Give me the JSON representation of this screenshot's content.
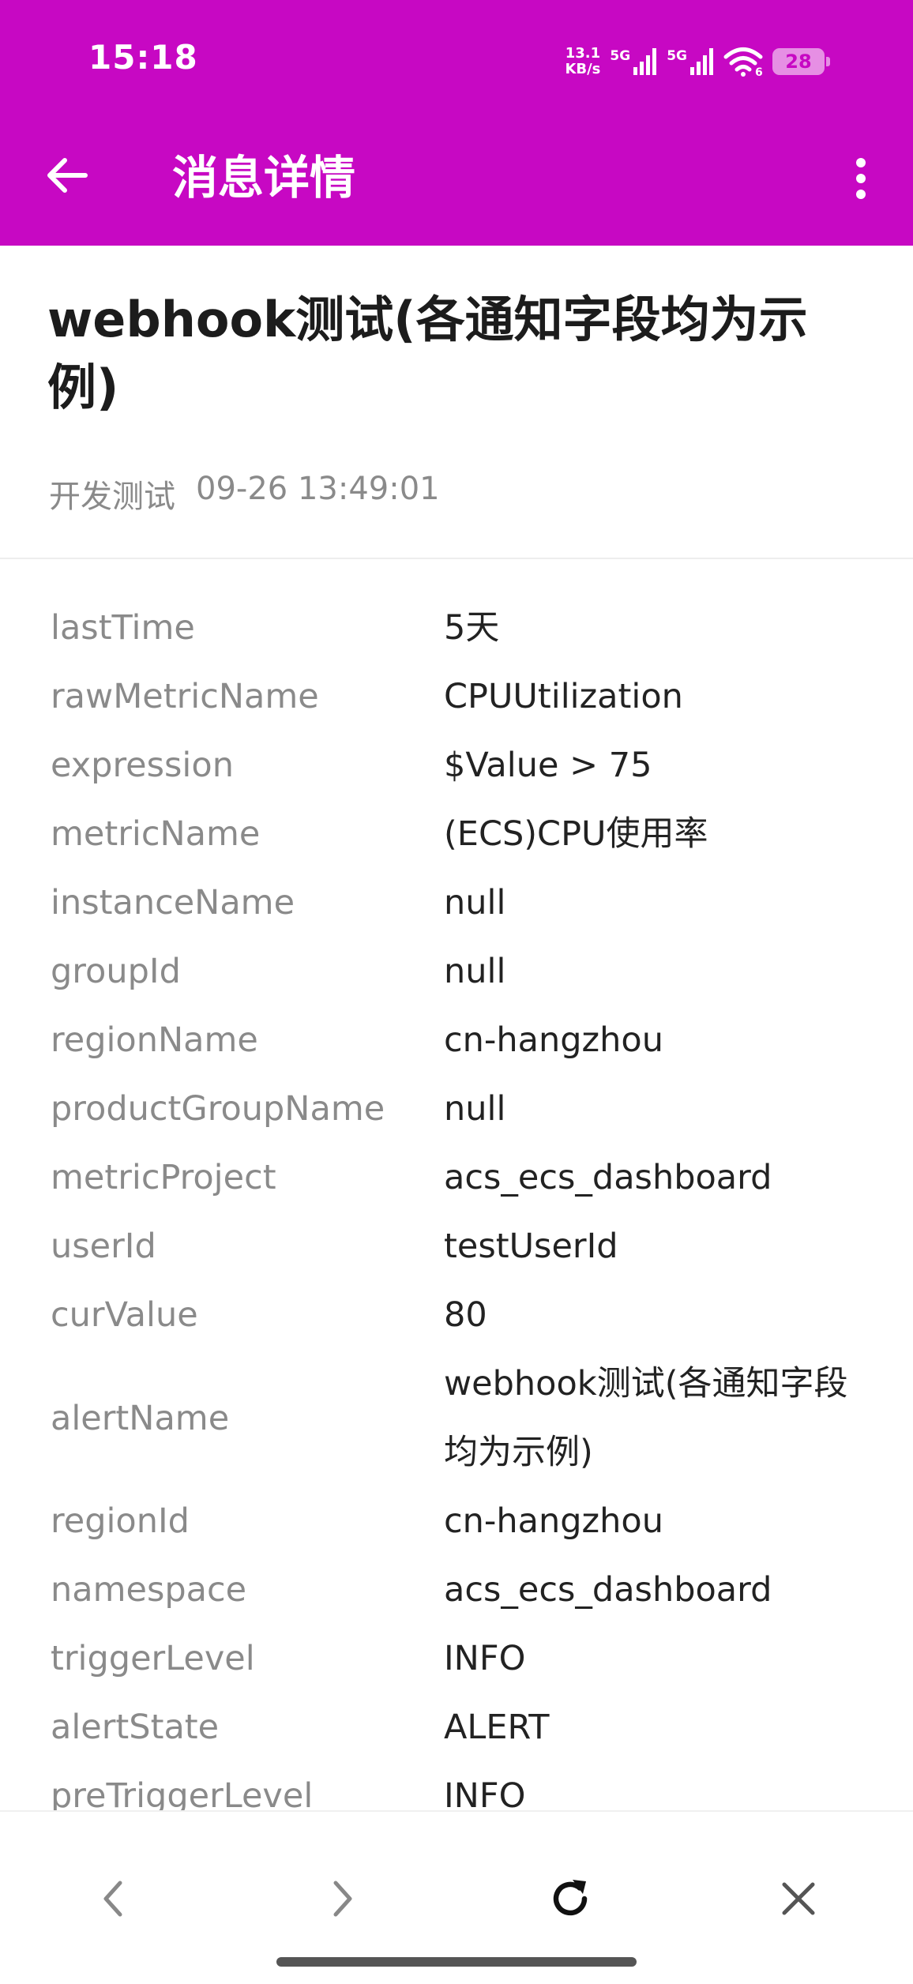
{
  "status_bar": {
    "time": "15:18",
    "net_speed_value": "13.1",
    "net_speed_unit": "KB/s",
    "sim1_tag": "5G",
    "sim2_tag": "5G",
    "wifi_badge": "6",
    "battery": "28"
  },
  "app_bar": {
    "title": "消息详情",
    "back_icon": "arrow-left-icon",
    "more_icon": "more-vertical-icon"
  },
  "message": {
    "title": "webhook测试(各通知字段均为示例)",
    "source": "开发测试",
    "time": "09-26 13:49:01"
  },
  "fields": [
    {
      "key": "lastTime",
      "value": "5天"
    },
    {
      "key": "rawMetricName",
      "value": "CPUUtilization"
    },
    {
      "key": "expression",
      "value": "$Value > 75"
    },
    {
      "key": "metricName",
      "value": "(ECS)CPU使用率"
    },
    {
      "key": "instanceName",
      "value": "null"
    },
    {
      "key": "groupId",
      "value": "null"
    },
    {
      "key": "regionName",
      "value": "cn-hangzhou"
    },
    {
      "key": "productGroupName",
      "value": "null"
    },
    {
      "key": "metricProject",
      "value": "acs_ecs_dashboard"
    },
    {
      "key": "userId",
      "value": "testUserId"
    },
    {
      "key": "curValue",
      "value": "80"
    },
    {
      "key": "alertName",
      "value": "webhook测试(各通知字段均为示例)"
    },
    {
      "key": "regionId",
      "value": "cn-hangzhou"
    },
    {
      "key": "namespace",
      "value": "acs_ecs_dashboard"
    },
    {
      "key": "triggerLevel",
      "value": "INFO"
    },
    {
      "key": "alertState",
      "value": "ALERT"
    },
    {
      "key": "preTriggerLevel",
      "value": "INFO"
    }
  ],
  "bottom_nav": {
    "back_icon": "chevron-left-icon",
    "forward_icon": "chevron-right-icon",
    "refresh_icon": "refresh-icon",
    "close_icon": "close-icon"
  },
  "colors": {
    "header": "#C708C3",
    "key_text": "#8a8a8a",
    "value_text": "#222222"
  }
}
